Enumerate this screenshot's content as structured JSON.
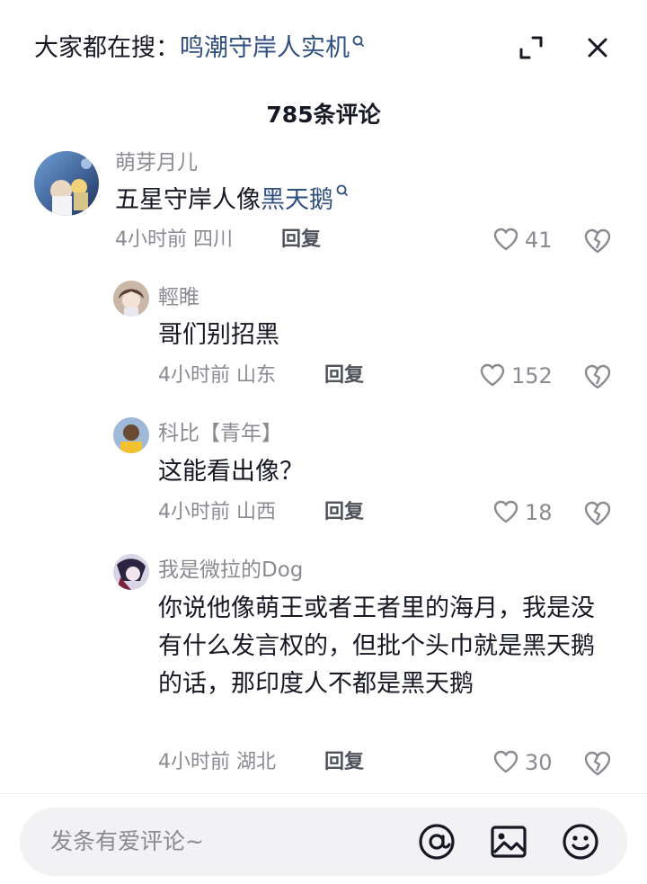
{
  "header": {
    "search_prefix": "大家都在搜：",
    "search_term": "鸣潮守岸人实机",
    "expand_icon": "expand-icon",
    "close_icon": "close-icon"
  },
  "comment_count": "785条评论",
  "comments": [
    {
      "name": "萌芽月儿",
      "text": "五星守岸人像",
      "link": "黑天鹅",
      "time": "4小时前",
      "location": "四川",
      "reply": "回复",
      "likes": "41"
    },
    {
      "name": "輕睢",
      "text": "哥们别招黑",
      "time": "4小时前",
      "location": "山东",
      "reply": "回复",
      "likes": "152"
    },
    {
      "name": "科比【青年】",
      "text": "这能看出像？",
      "time": "4小时前",
      "location": "山西",
      "reply": "回复",
      "likes": "18"
    },
    {
      "name": "我是微拉的Dog",
      "text": "你说他像萌王或者王者里的海月，我是没有什么发言权的，但批个头巾就是黑天鹅的话，那印度人不都是黑天鹅",
      "time": "4小时前",
      "location": "湖北",
      "reply": "回复",
      "likes": "30"
    }
  ],
  "input": {
    "placeholder": "发条有爱评论~",
    "icons": [
      "at-icon",
      "image-icon",
      "emoji-icon"
    ]
  },
  "colors": {
    "link": "#2f4f7f",
    "secondary_text": "#8a8b91",
    "input_bg": "#f2f2f4"
  }
}
